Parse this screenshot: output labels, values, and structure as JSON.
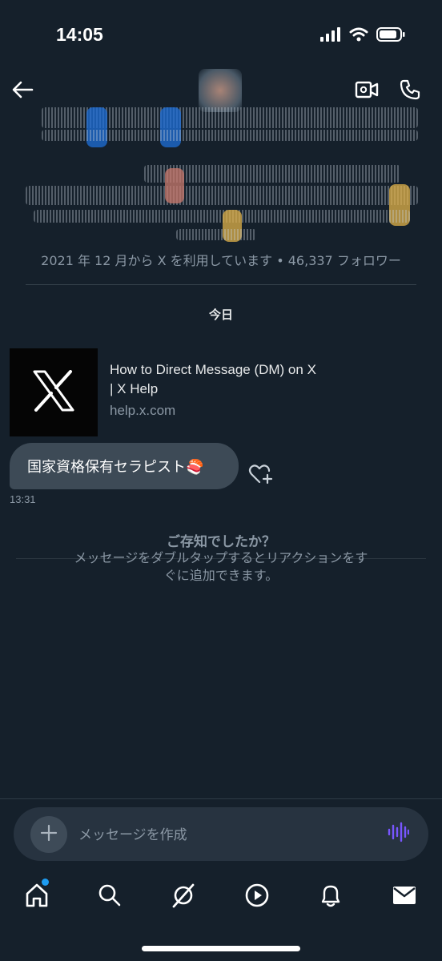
{
  "status_bar": {
    "time": "14:05",
    "icons": [
      "cellular-signal-icon",
      "wifi-icon",
      "battery-icon"
    ]
  },
  "header": {
    "icons": [
      "back-arrow-icon",
      "video-call-icon",
      "phone-call-icon"
    ]
  },
  "profile": {
    "meta": "2021 年 12 月から X を利用しています • 46,337 フォロワー"
  },
  "conversation": {
    "day_label": "今日",
    "link_card": {
      "title": "How to Direct Message (DM) on X | X Help",
      "domain": "help.x.com",
      "thumb_icon": "x-logo-icon"
    },
    "message": {
      "text": "国家資格保有セラピスト🍣",
      "time": "13:31"
    },
    "tip": {
      "title": "ご存知でしたか？",
      "body": "メッセージをダブルタップするとリアクションをすぐに追加できます。"
    }
  },
  "composer": {
    "placeholder": "メッセージを作成"
  },
  "tab_bar": {
    "items": [
      "home-icon",
      "search-icon",
      "grok-icon",
      "video-play-icon",
      "notifications-bell-icon",
      "messages-envelope-icon"
    ],
    "home_has_badge": true
  },
  "colors": {
    "background": "#15202b",
    "bubble": "#3d4a56",
    "muted_text": "#8b98a5",
    "accent": "#1d9bf0",
    "voice_accent": "#7856ff"
  }
}
